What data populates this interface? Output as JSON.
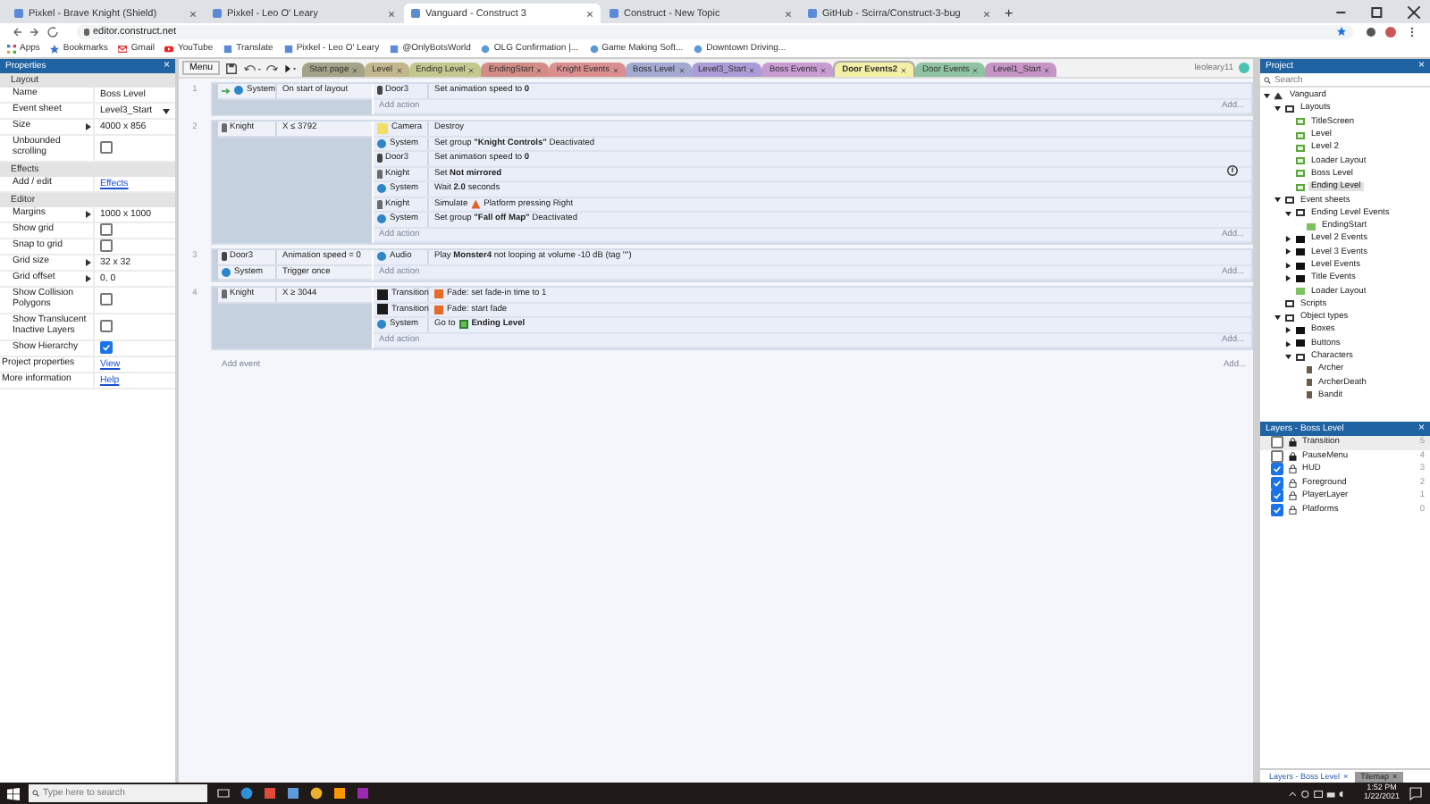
{
  "browser": {
    "tabs": [
      {
        "title": "Pixkel - Brave Knight (Shield)",
        "selected": false
      },
      {
        "title": "Pixkel - Leo O' Leary",
        "selected": false
      },
      {
        "title": "Vanguard - Construct 3",
        "selected": true
      },
      {
        "title": "Construct - New Topic",
        "selected": false
      },
      {
        "title": "GitHub - Scirra/Construct-3-bug",
        "selected": false
      }
    ],
    "new_tab": "+",
    "url": "editor.construct.net",
    "bookmarks": [
      {
        "label": "Apps",
        "kind": "grid"
      },
      {
        "label": "Bookmarks",
        "kind": "star"
      },
      {
        "label": "Gmail",
        "kind": "mail"
      },
      {
        "label": "YouTube",
        "kind": "play"
      },
      {
        "label": "Translate",
        "kind": "square"
      },
      {
        "label": "Pixkel - Leo O' Leary",
        "kind": "square"
      },
      {
        "label": "@OnlyBotsWorld",
        "kind": "square"
      },
      {
        "label": "OLG Confirmation |...",
        "kind": "globe"
      },
      {
        "label": "Game Making Soft...",
        "kind": "globe"
      },
      {
        "label": "Downtown Driving...",
        "kind": "globe"
      }
    ]
  },
  "properties": {
    "title": "Properties",
    "close": "×",
    "sections": [
      {
        "title": "Layout",
        "rows": [
          {
            "label": "Name",
            "kind": "text",
            "value": "Boss Level"
          },
          {
            "label": "Event sheet",
            "kind": "dropdown",
            "value": "Level3_Start"
          },
          {
            "label": "Size",
            "kind": "expand",
            "value": "4000 x 856"
          },
          {
            "label": "Unbounded scrolling",
            "kind": "check",
            "checked": false
          }
        ]
      },
      {
        "title": "Effects",
        "rows": [
          {
            "label": "Add / edit",
            "kind": "link",
            "value": "Effects"
          }
        ]
      },
      {
        "title": "Editor",
        "rows": [
          {
            "label": "Margins",
            "kind": "expand",
            "value": "1000 x 1000"
          },
          {
            "label": "Show grid",
            "kind": "check",
            "checked": false
          },
          {
            "label": "Snap to grid",
            "kind": "check",
            "checked": false
          },
          {
            "label": "Grid size",
            "kind": "expand",
            "value": "32 x 32"
          },
          {
            "label": "Grid offset",
            "kind": "expand",
            "value": "0, 0"
          },
          {
            "label": "Show Collision Polygons",
            "kind": "check",
            "checked": false
          },
          {
            "label": "Show Translucent Inactive Layers",
            "kind": "check",
            "checked": false
          },
          {
            "label": "Show Hierarchy",
            "kind": "check",
            "checked": true
          }
        ]
      }
    ],
    "footer": [
      {
        "label": "Project properties",
        "value": "View"
      },
      {
        "label": "More information",
        "value": "Help"
      }
    ]
  },
  "toolbar": {
    "menu": "Menu",
    "user": "leoleary11"
  },
  "sheet_tabs": [
    {
      "label": "Start page",
      "color": "#a3a38a",
      "selected": false
    },
    {
      "label": "Level",
      "color": "#c2b78c",
      "selected": false
    },
    {
      "label": "Ending Level",
      "color": "#c3c98e",
      "selected": false
    },
    {
      "label": "EndingStart",
      "color": "#d48c86",
      "selected": false
    },
    {
      "label": "Knight Events",
      "color": "#dc8f90",
      "selected": false
    },
    {
      "label": "Boss Level",
      "color": "#a3a9d0",
      "selected": false
    },
    {
      "label": "Level3_Start",
      "color": "#ab9bd6",
      "selected": false
    },
    {
      "label": "Boss Events",
      "color": "#c89bd2",
      "selected": false
    },
    {
      "label": "Door Events2",
      "color": "#f3efa6",
      "selected": true
    },
    {
      "label": "Door Events",
      "color": "#8fc3a3",
      "selected": false
    },
    {
      "label": "Level1_Start",
      "color": "#c594c4",
      "selected": false
    }
  ],
  "events": [
    {
      "number": "1",
      "conditions": [
        {
          "object": "System",
          "kind": "system",
          "text": "On start of layout",
          "trigger": true
        }
      ],
      "actions": [
        {
          "object": "Door3",
          "kind": "door",
          "text": "Set animation speed to **0**"
        }
      ],
      "add_action": "Add action",
      "add_hint": "Add..."
    },
    {
      "number": "2",
      "conditions": [
        {
          "object": "Knight",
          "kind": "sprite",
          "text": "X ≤ 3792",
          "trigger": false
        }
      ],
      "actions": [
        {
          "object": "Camera",
          "kind": "camera",
          "text": "Destroy"
        },
        {
          "object": "System",
          "kind": "system",
          "text": "Set group **\"Knight Controls\"** Deactivated"
        },
        {
          "object": "Door3",
          "kind": "door",
          "text": "Set animation speed to **0**"
        },
        {
          "object": "Knight",
          "kind": "sprite",
          "text": "Set **Not mirrored**"
        },
        {
          "object": "System",
          "kind": "system",
          "text": "Wait **2.0** seconds"
        },
        {
          "object": "Knight",
          "kind": "sprite",
          "pre": "Simulate",
          "inline": {
            "kind": "platform"
          },
          "text": "Platform pressing Right"
        },
        {
          "object": "System",
          "kind": "system",
          "text": "Set group **\"Fall off Map\"** Deactivated"
        }
      ],
      "add_action": "Add action",
      "add_hint": "Add..."
    },
    {
      "number": "3",
      "conditions": [
        {
          "object": "Door3",
          "kind": "door",
          "text": "Animation speed = 0",
          "trigger": false
        },
        {
          "object": "System",
          "kind": "system",
          "text": "Trigger once",
          "trigger": false
        }
      ],
      "actions": [
        {
          "object": "Audio",
          "kind": "audio",
          "text": "Play **Monster4** not looping at volume -10 dB (tag \"\")"
        }
      ],
      "add_action": "Add action",
      "add_hint": "Add..."
    },
    {
      "number": "4",
      "conditions": [
        {
          "object": "Knight",
          "kind": "sprite",
          "text": "X ≥ 3044",
          "trigger": false
        }
      ],
      "actions": [
        {
          "object": "Transition",
          "kind": "transition",
          "inline": {
            "kind": "fade"
          },
          "text": "Fade: set fade-in time to 1"
        },
        {
          "object": "Transition",
          "kind": "transition",
          "inline": {
            "kind": "fade"
          },
          "text": "Fade: start fade"
        },
        {
          "object": "System",
          "kind": "system",
          "pre": "Go to",
          "inline": {
            "kind": "layout"
          },
          "text": "**Ending Level**"
        }
      ],
      "add_action": "Add action",
      "add_hint": "Add..."
    }
  ],
  "add_event": "Add event",
  "add_event_hint": "Add...",
  "project": {
    "title": "Project",
    "close": "×",
    "search": {
      "placeholder": "Search"
    },
    "tree": [
      {
        "label": "Vanguard",
        "kind": "project",
        "expanded": true,
        "selected": false,
        "children": [
          {
            "label": "Layouts",
            "kind": "folder",
            "expanded": true,
            "selected": false,
            "children": [
              {
                "label": "TitleScreen",
                "kind": "layout",
                "selected": false
              },
              {
                "label": "Level",
                "kind": "layout",
                "selected": false
              },
              {
                "label": "Level 2",
                "kind": "layout",
                "selected": false
              },
              {
                "label": "Loader Layout",
                "kind": "layout",
                "selected": false
              },
              {
                "label": "Boss Level",
                "kind": "layout",
                "selected": false
              },
              {
                "label": "Ending Level",
                "kind": "layout",
                "selected": true
              }
            ]
          },
          {
            "label": "Event sheets",
            "kind": "folder",
            "expanded": true,
            "selected": false,
            "children": [
              {
                "label": "Ending Level Events",
                "kind": "folder",
                "expanded": true,
                "selected": false,
                "children": [
                  {
                    "label": "EndingStart",
                    "kind": "sheet",
                    "selected": false
                  }
                ]
              },
              {
                "label": "Level 2 Events",
                "kind": "filled",
                "expanded": false,
                "selected": false
              },
              {
                "label": "Level 3 Events",
                "kind": "filled",
                "expanded": false,
                "selected": false
              },
              {
                "label": "Level Events",
                "kind": "filled",
                "expanded": false,
                "selected": false
              },
              {
                "label": "Title Events",
                "kind": "filled",
                "expanded": false,
                "selected": false
              },
              {
                "label": "Loader Layout",
                "kind": "sheet",
                "selected": false
              }
            ]
          },
          {
            "label": "Scripts",
            "kind": "folder",
            "selected": false
          },
          {
            "label": "Object types",
            "kind": "folder",
            "expanded": true,
            "selected": false,
            "children": [
              {
                "label": "Boxes",
                "kind": "filled",
                "expanded": false,
                "selected": false
              },
              {
                "label": "Buttons",
                "kind": "filled",
                "expanded": false,
                "selected": false
              },
              {
                "label": "Characters",
                "kind": "folder",
                "expanded": true,
                "selected": false,
                "children": [
                  {
                    "label": "Archer",
                    "kind": "sprite",
                    "selected": false
                  },
                  {
                    "label": "ArcherDeath",
                    "kind": "sprite",
                    "selected": false
                  },
                  {
                    "label": "Bandit",
                    "kind": "sprite",
                    "selected": false
                  }
                ]
              }
            ]
          }
        ]
      }
    ]
  },
  "layers": {
    "title": "Layers - Boss Level",
    "close": "×",
    "items": [
      {
        "name": "Transition",
        "index": "5",
        "visible": false,
        "locked": true,
        "selected": true
      },
      {
        "name": "PauseMenu",
        "index": "4",
        "visible": false,
        "locked": true,
        "selected": false
      },
      {
        "name": "HUD",
        "index": "3",
        "visible": true,
        "locked": false,
        "selected": false
      },
      {
        "name": "Foreground",
        "index": "2",
        "visible": true,
        "locked": false,
        "selected": false
      },
      {
        "name": "PlayerLayer",
        "index": "1",
        "visible": true,
        "locked": false,
        "selected": false
      },
      {
        "name": "Platforms",
        "index": "0",
        "visible": true,
        "locked": false,
        "selected": false
      }
    ],
    "tabs": [
      {
        "label": "Layers - Boss Level",
        "close": "×",
        "selected": true
      },
      {
        "label": "Tilemap",
        "close": "×",
        "selected": false
      }
    ]
  },
  "taskbar": {
    "search": {
      "placeholder": "Type here to search"
    },
    "time": "1:52 PM",
    "date": "1/22/2021"
  }
}
